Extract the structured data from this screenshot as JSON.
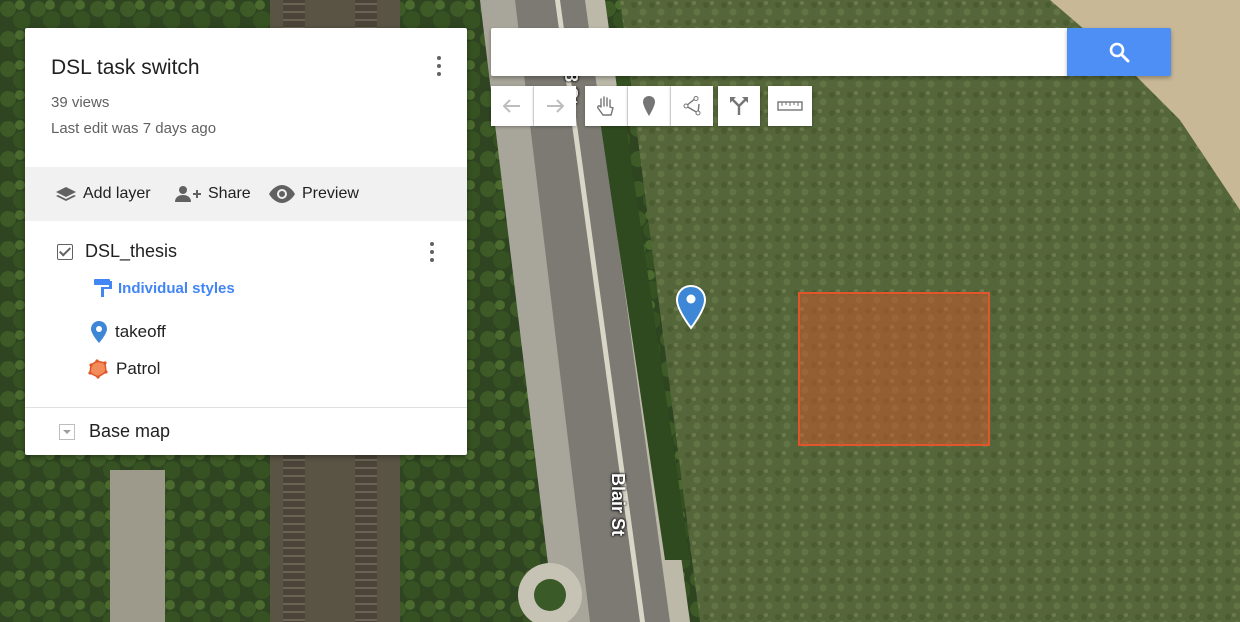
{
  "map": {
    "street_label_bottom": "Blair St",
    "street_label_top": "8 St",
    "marker_color": "#3d87d6",
    "polygon_color": "#e0562a"
  },
  "panel": {
    "title": "DSL task switch",
    "views": "39 views",
    "last_edit": "Last edit was 7 days ago",
    "actions": {
      "add_layer": "Add layer",
      "share": "Share",
      "preview": "Preview"
    },
    "layer": {
      "name": "DSL_thesis",
      "checked": true,
      "styles_label": "Individual styles",
      "features": [
        {
          "label": "takeoff",
          "icon": "location-pin-icon"
        },
        {
          "label": "Patrol",
          "icon": "polygon-icon"
        }
      ]
    },
    "base_map_label": "Base map"
  },
  "search": {
    "value": "",
    "placeholder": ""
  },
  "toolbar": {
    "tools": [
      "undo-icon",
      "redo-icon",
      "hand-icon",
      "marker-icon",
      "line-icon",
      "directions-icon",
      "ruler-icon"
    ]
  },
  "colors": {
    "accent": "#4d8ff5",
    "actions_bg": "#f1f1f1"
  }
}
